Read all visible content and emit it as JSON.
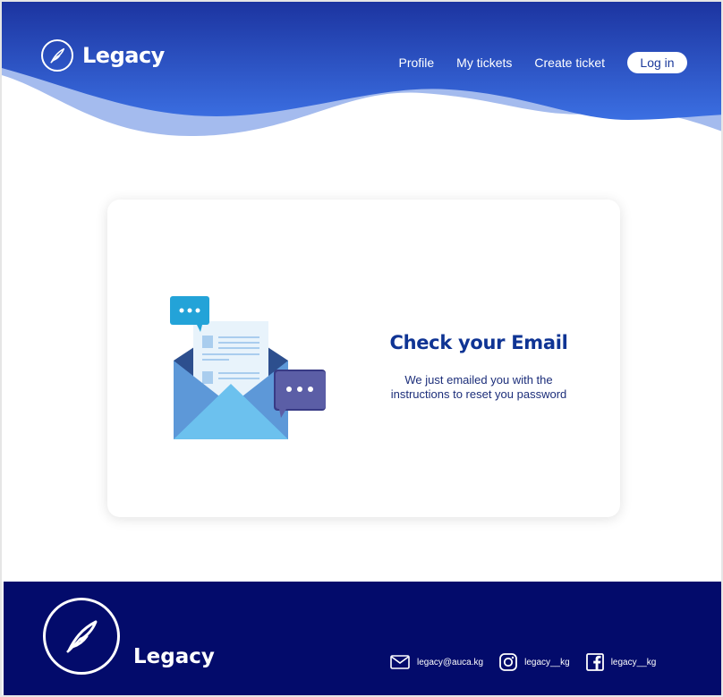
{
  "header": {
    "brand": "Legacy",
    "nav": {
      "profile": "Profile",
      "my_tickets": "My tickets",
      "create_ticket": "Create ticket",
      "login": "Log in"
    }
  },
  "card": {
    "title": "Check  your Email",
    "message_line1": "We just emailed you with the",
    "message_line2": "instructions to reset you password"
  },
  "footer": {
    "brand": "Legacy",
    "email": "legacy@auca.kg",
    "instagram": "legacy__kg",
    "facebook": "legacy__kg"
  },
  "colors": {
    "header_top": "#1e3aa8",
    "header_bottom": "#3a6be0",
    "wave_light": "#9fb6ec",
    "title": "#0f3494",
    "footer_bg": "#030b6b"
  },
  "icons": {
    "brand": "feather-logo-icon",
    "email": "envelope-icon",
    "instagram": "instagram-icon",
    "facebook": "facebook-icon"
  }
}
